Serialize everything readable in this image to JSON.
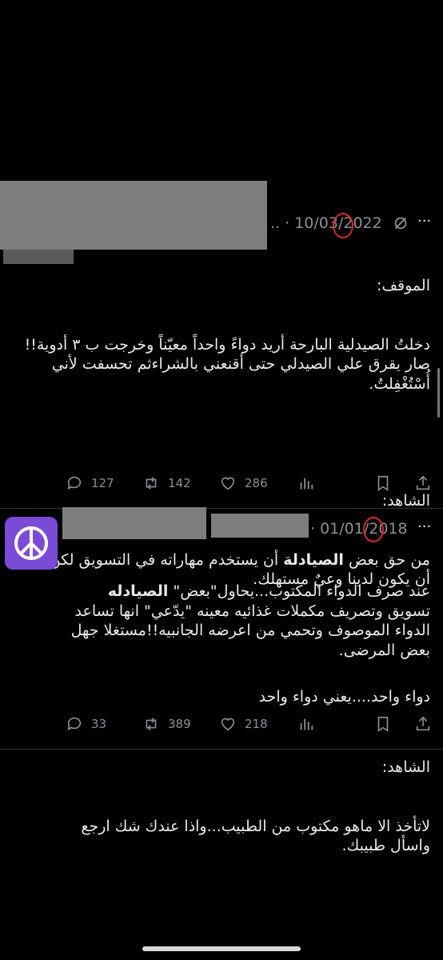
{
  "tweets": [
    {
      "date": "10/03/2022",
      "ellipsis": "..",
      "situation_label": "الموقف:",
      "situation_text": "دخلتُ الصيدلية البارحة أريد دواءً واحداً معيّناً وخرجت ب ٣ أدوية!!\nصار يقرق علي الصيدلي حتى أقنعني بالشراءثم تحسفت لأني أُسْتُغْفِلتُ.",
      "witness_label": "الشاهد:",
      "witness_pre": "من حق بعض ",
      "witness_bold": "الصيادلة",
      "witness_post": " أن يستخدم مهاراته في التسويق لكن يجب أن يكون لدينا وعيٌ مستهلك.",
      "closing": "دواء واحد....يعني دواء واحد",
      "replies": "127",
      "retweets": "142",
      "likes": "286"
    },
    {
      "date": "01/01/2018",
      "text_pre": "عند صرف الدواء المكتوب...يحاول\"بعض\" ",
      "text_bold": "الصيادله",
      "text_post": " تسويق وتصريف مكملات غذائيه معينه \"يدّعي\" انها تساعد الدواء الموصوف وتحمي من اعرضه الجانبيه!!مستغلا جهل بعض المرضى.",
      "witness_label": "الشاهد:",
      "witness_text": "لاتأخذ الا ماهو مكتوب من الطبيب...واذا عندك شك ارجع واسأل طبيبك.",
      "replies": "33",
      "retweets": "389",
      "likes": "218",
      "avatar_icon": "peace-sign-icon"
    }
  ],
  "colors": {
    "background": "#000000",
    "muted": "#8b8f94",
    "avatar": "#7a4bd6",
    "marker": "#d7262e"
  }
}
